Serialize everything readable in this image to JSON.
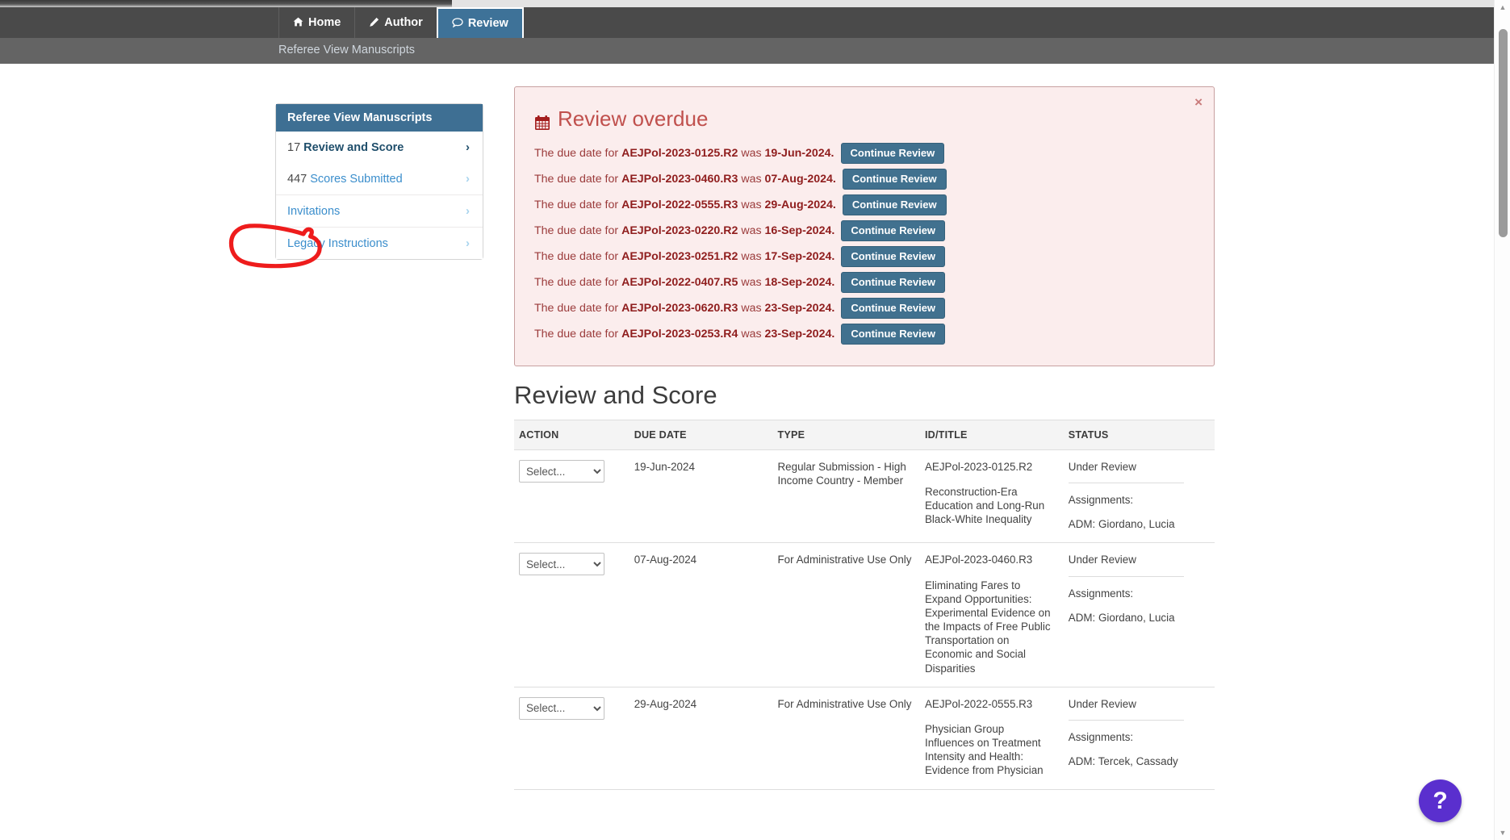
{
  "navbar": {
    "items": [
      {
        "label": "Home",
        "icon": "home-icon",
        "glyph": "⌂",
        "active": false
      },
      {
        "label": "Author",
        "icon": "pencil-icon",
        "glyph": "✎",
        "active": false
      },
      {
        "label": "Review",
        "icon": "comment-icon",
        "glyph": "○",
        "active": true
      }
    ]
  },
  "breadcrumb": {
    "text": "Referee View Manuscripts"
  },
  "sidebar": {
    "header": "Referee View Manuscripts",
    "items": [
      {
        "count": "17",
        "label": "Review and Score",
        "style": "strong",
        "chevron": "dark",
        "rule": false
      },
      {
        "count": "447",
        "label": "Scores Submitted",
        "style": "link",
        "chevron": "light",
        "rule": false
      },
      {
        "count": "",
        "label": "Invitations",
        "style": "link",
        "chevron": "light",
        "rule": true
      },
      {
        "count": "",
        "label": "Legacy Instructions",
        "style": "link",
        "chevron": "light",
        "rule": true
      }
    ],
    "annotation": {
      "target": "Invitations",
      "color": "#ee1c1c",
      "shape": "hand-drawn-ellipse"
    }
  },
  "alert": {
    "title": "Review overdue",
    "icon": "calendar-icon",
    "close_label": "×",
    "accent_color": "#c0504d",
    "background": "#fbeded",
    "lead": "The due date for",
    "mid": "was",
    "button_label": "Continue Review",
    "rows": [
      {
        "id": "AEJPol-2023-0125.R2",
        "date": "19-Jun-2024."
      },
      {
        "id": "AEJPol-2023-0460.R3",
        "date": "07-Aug-2024."
      },
      {
        "id": "AEJPol-2022-0555.R3",
        "date": "29-Aug-2024."
      },
      {
        "id": "AEJPol-2023-0220.R2",
        "date": "16-Sep-2024."
      },
      {
        "id": "AEJPol-2023-0251.R2",
        "date": "17-Sep-2024."
      },
      {
        "id": "AEJPol-2022-0407.R5",
        "date": "18-Sep-2024."
      },
      {
        "id": "AEJPol-2023-0620.R3",
        "date": "23-Sep-2024."
      },
      {
        "id": "AEJPol-2023-0253.R4",
        "date": "23-Sep-2024."
      }
    ]
  },
  "section": {
    "title": "Review and Score"
  },
  "table": {
    "columns": [
      "ACTION",
      "DUE DATE",
      "TYPE",
      "ID/TITLE",
      "STATUS"
    ],
    "select_placeholder": "Select...",
    "assignments_label": "Assignments:",
    "rows": [
      {
        "action": "Select...",
        "due_date": "19-Jun-2024",
        "type": "Regular Submission - High Income Country - Member",
        "id": "AEJPol-2023-0125.R2",
        "title": "Reconstruction-Era Education and Long-Run Black-White Inequality",
        "status": "Under Review",
        "assignment": "ADM: Giordano, Lucia"
      },
      {
        "action": "Select...",
        "due_date": "07-Aug-2024",
        "type": "For Administrative Use Only",
        "id": "AEJPol-2023-0460.R3",
        "title": "Eliminating Fares to Expand Opportunities: Experimental Evidence on the Impacts of Free Public Transportation on Economic and Social Disparities",
        "status": "Under Review",
        "assignment": "ADM: Giordano, Lucia"
      },
      {
        "action": "Select...",
        "due_date": "29-Aug-2024",
        "type": "For Administrative Use Only",
        "id": "AEJPol-2022-0555.R3",
        "title": "Physician Group Influences on Treatment Intensity and Health: Evidence from Physician",
        "status": "Under Review",
        "assignment": "ADM: Tercek, Cassady"
      }
    ]
  },
  "help": {
    "label": "?",
    "color": "#5a2fce"
  },
  "scrollbar": {
    "up": "▲",
    "down": "▼"
  }
}
